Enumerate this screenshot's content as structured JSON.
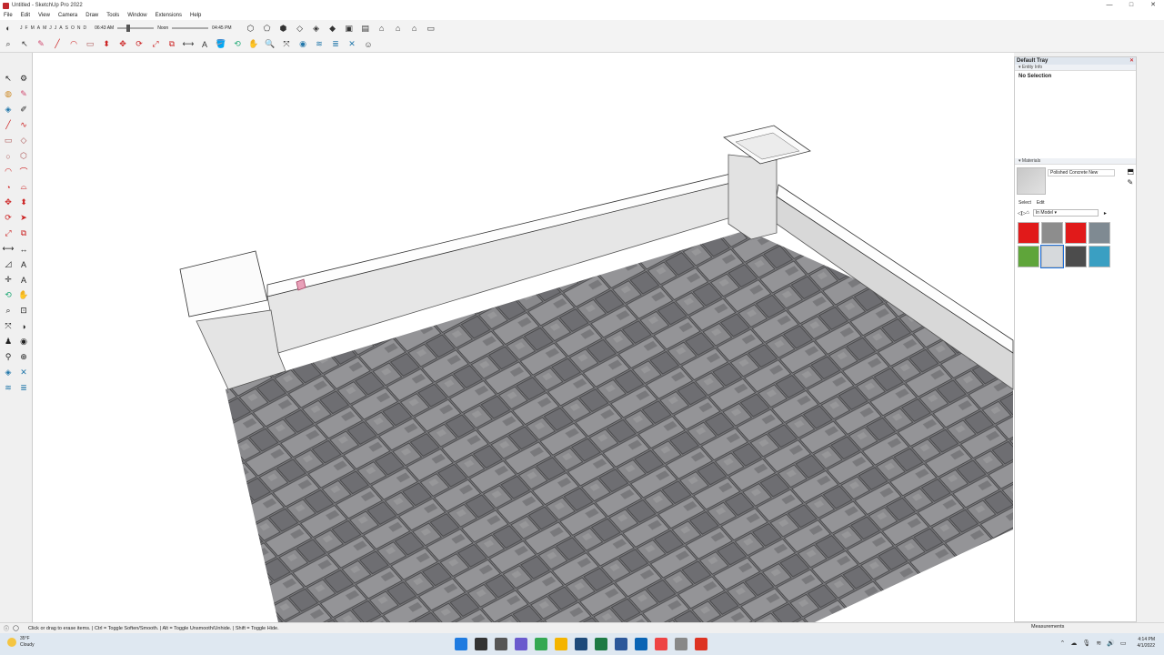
{
  "window": {
    "title": "Untitled - SketchUp Pro 2022",
    "controls": [
      "—",
      "□",
      "✕"
    ]
  },
  "menu": [
    "File",
    "Edit",
    "View",
    "Camera",
    "Draw",
    "Tools",
    "Window",
    "Extensions",
    "Help"
  ],
  "shadows": {
    "months": [
      "J",
      "F",
      "M",
      "A",
      "M",
      "J",
      "J",
      "A",
      "S",
      "O",
      "N",
      "D"
    ],
    "time_start": "06:43 AM",
    "time_mid": "Noon",
    "time_end": "04:45 PM"
  },
  "tray": {
    "title": "Default Tray",
    "entity_info": {
      "header": "Entity Info",
      "selection": "No Selection"
    },
    "materials": {
      "header": "Materials",
      "current_name": "Polished Concrete New",
      "tab_select": "Select",
      "tab_edit": "Edit",
      "library": "In Model",
      "swatch_colors": [
        "#e11a1a",
        "#8d8d8d",
        "#e11a1a",
        "#7f8a92",
        "#5fa53a",
        "#d6d9dc",
        "#4c4c4c",
        "#3a9fc2"
      ]
    }
  },
  "status": {
    "hint": "Click or drag to erase items. | Ctrl = Toggle Soften/Smooth. | Alt = Toggle Unsmooth/Unhide. | Shift = Toggle Hide.",
    "measurements_label": "Measurements"
  },
  "taskbar": {
    "weather_temp": "35°F",
    "weather_desc": "Cloudy",
    "time": "4:14 PM",
    "date": "4/1/2022"
  }
}
